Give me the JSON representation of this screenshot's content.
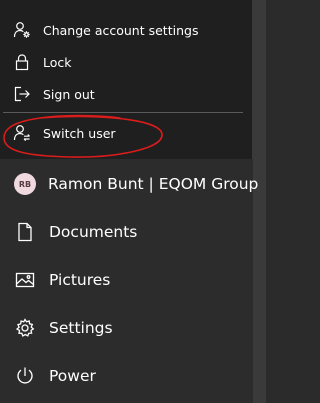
{
  "account_menu": {
    "items": [
      {
        "label": "Change account settings",
        "icon": "account-settings-icon"
      },
      {
        "label": "Lock",
        "icon": "lock-icon"
      },
      {
        "label": "Sign out",
        "icon": "sign-out-icon"
      },
      {
        "label": "Switch user",
        "icon": "switch-user-icon"
      }
    ]
  },
  "start_rail": {
    "user": {
      "initials": "RB",
      "name": "Ramon Bunt | EQOM Group"
    },
    "items": [
      {
        "label": "Documents",
        "icon": "document-icon"
      },
      {
        "label": "Pictures",
        "icon": "pictures-icon"
      },
      {
        "label": "Settings",
        "icon": "gear-icon"
      },
      {
        "label": "Power",
        "icon": "power-icon"
      }
    ]
  },
  "colors": {
    "flyout_bg": "#1f1f1f",
    "rail_bg": "#2c2c2c",
    "annotation": "#d91c1c",
    "avatar_bg": "#f0d9df"
  }
}
